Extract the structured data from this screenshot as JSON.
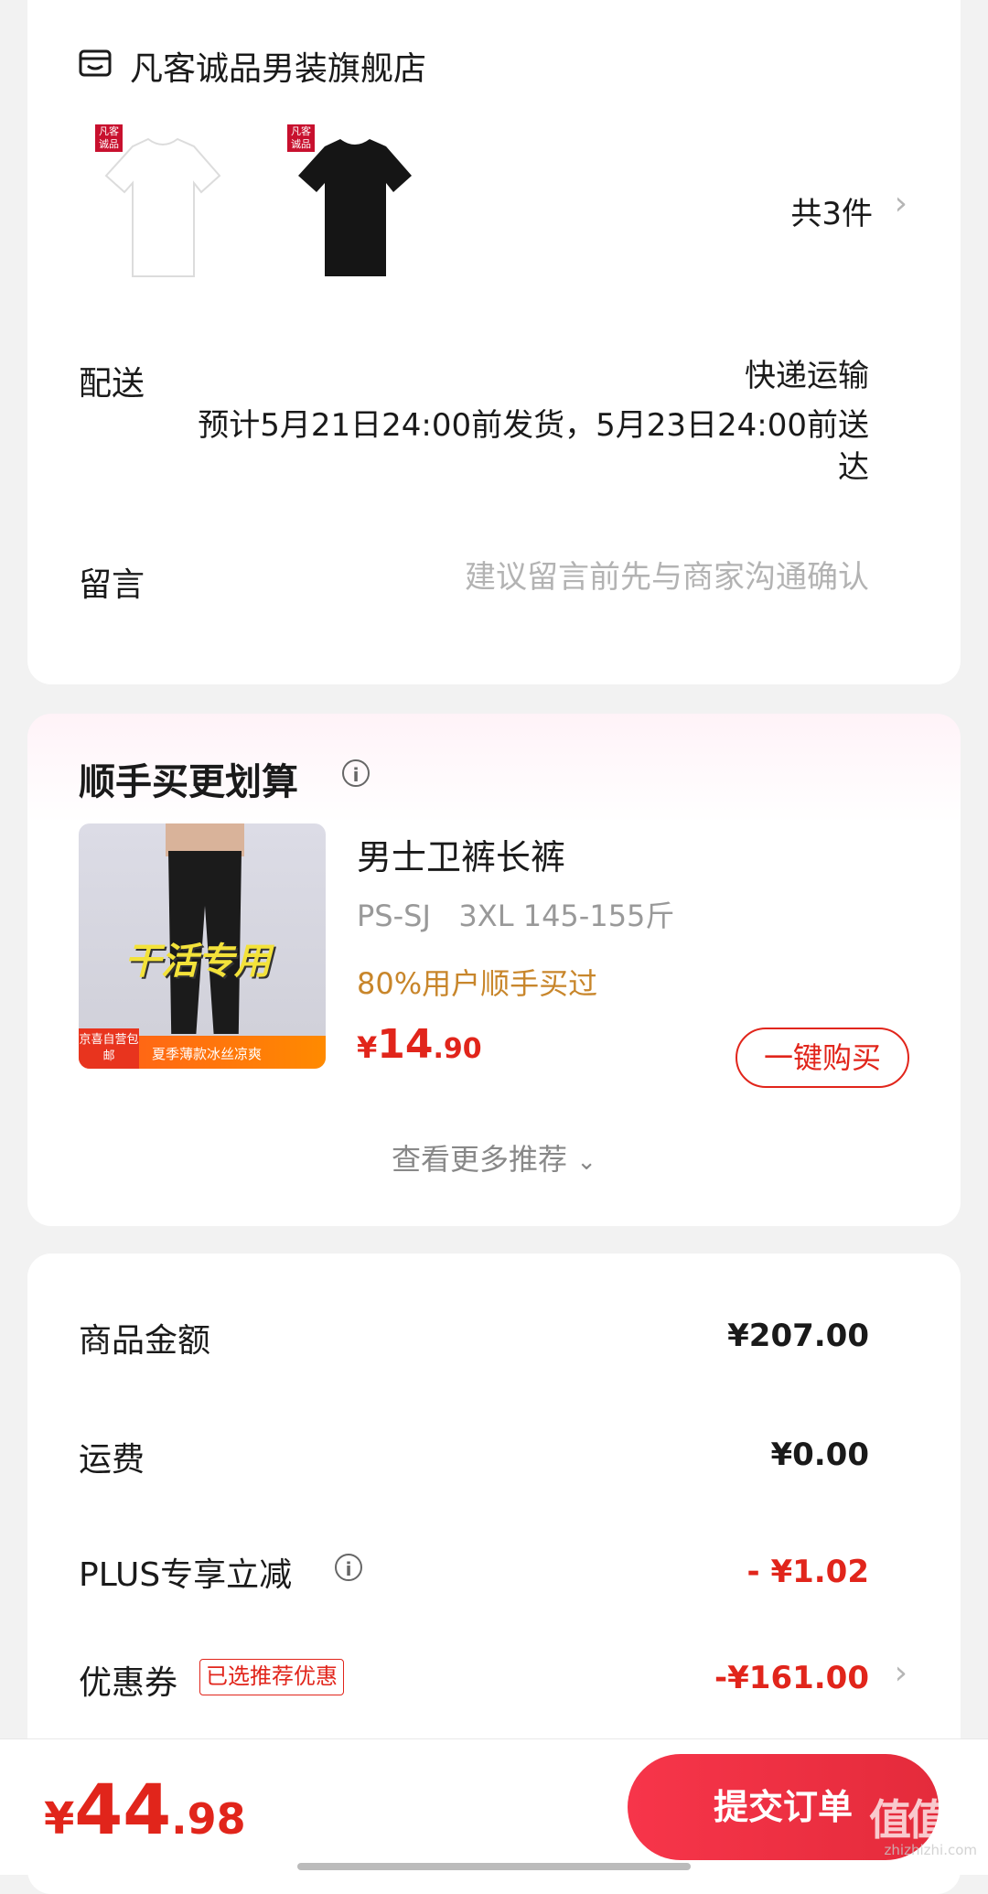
{
  "store": {
    "name": "凡客诚品男装旗舰店",
    "thumb_badge": "凡客诚品",
    "item_count": "共3件",
    "delivery_label": "配送",
    "delivery_method": "快递运输",
    "delivery_estimate": "预计5月21日24:00前发货，5月23日24:00前送达",
    "message_label": "留言",
    "message_placeholder": "建议留言前先与商家沟通确认"
  },
  "recommend": {
    "title": "顺手买更划算",
    "image_text": "干活专用",
    "image_badge": "京喜自营包邮",
    "image_caption": "夏季薄款冰丝凉爽",
    "product_name": "男士卫裤长裤",
    "spec": "PS-SJ   3XL 145-155斤",
    "stat": "80%用户顺手买过",
    "price_symbol": "¥",
    "price_int": "14",
    "price_dec": ".90",
    "buy_label": "一键购买",
    "more_label": "查看更多推荐"
  },
  "summary": {
    "goods_label": "商品金额",
    "goods_value": "¥207.00",
    "shipping_label": "运费",
    "shipping_value": "¥0.00",
    "plus_label": "PLUS专享立减",
    "plus_value": "- ¥1.02",
    "coupon_label": "优惠券",
    "coupon_tag": "已选推荐优惠",
    "coupon_value": "-¥161.00"
  },
  "bottom": {
    "price_symbol": "¥",
    "price_int": "44",
    "price_dec": ".98",
    "submit_label": "提交订单",
    "watermark": "值值值",
    "watermark_domain": "zhizhizhi.com"
  },
  "icons": {
    "chevron": "chevron-right-icon",
    "info": "info-icon",
    "store": "store-icon",
    "expand": "chevron-down-icon"
  },
  "colors": {
    "accent_red": "#e1251b",
    "submit_gradient_start": "#f7354a",
    "stat_orange": "#c8862b"
  }
}
